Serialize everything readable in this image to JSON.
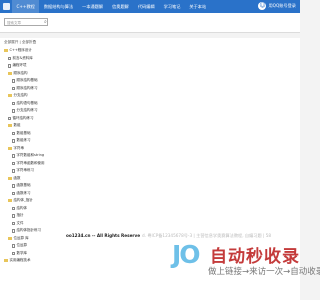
{
  "header": {
    "nav": [
      "C++教程",
      "数据结构与算法",
      "一本通题解",
      "信奥题解",
      "代码编辑",
      "学习笔记",
      "关于本站"
    ],
    "login_label": "用QQ账号登录"
  },
  "search": {
    "placeholder": "搜索文章",
    "button_icon": "search-icon"
  },
  "sidebar": {
    "breadcrumb": "全部展开 | 全部折叠",
    "tree": [
      {
        "label": "C++程序设计",
        "type": "folder",
        "level": 0
      },
      {
        "label": "前言&资料库",
        "type": "file",
        "level": 1
      },
      {
        "label": "编程环境",
        "type": "file",
        "level": 1
      },
      {
        "label": "顺序结构",
        "type": "folder",
        "level": 1
      },
      {
        "label": "顺序结构基础",
        "type": "file",
        "level": 2
      },
      {
        "label": "顺序结构练习",
        "type": "file",
        "level": 2
      },
      {
        "label": "分支结构",
        "type": "folder",
        "level": 1
      },
      {
        "label": "结构语句基础",
        "type": "file",
        "level": 2
      },
      {
        "label": "分支结构练习",
        "type": "file",
        "level": 2
      },
      {
        "label": "循环结构练习",
        "type": "file",
        "level": 1
      },
      {
        "label": "数组",
        "type": "folder",
        "level": 1
      },
      {
        "label": "数组基础",
        "type": "file",
        "level": 2
      },
      {
        "label": "数组练习",
        "type": "file",
        "level": 2
      },
      {
        "label": "字符串",
        "type": "folder",
        "level": 1
      },
      {
        "label": "字符数组和string",
        "type": "file",
        "level": 2
      },
      {
        "label": "字符串函数和使用",
        "type": "file",
        "level": 2
      },
      {
        "label": "字符串练习",
        "type": "file",
        "level": 2
      },
      {
        "label": "函数",
        "type": "folder",
        "level": 1
      },
      {
        "label": "函数基础",
        "type": "file",
        "level": 2
      },
      {
        "label": "函数练习",
        "type": "file",
        "level": 2
      },
      {
        "label": "结构体_指针",
        "type": "folder",
        "level": 1
      },
      {
        "label": "结构体",
        "type": "file",
        "level": 2
      },
      {
        "label": "指针",
        "type": "file",
        "level": 2
      },
      {
        "label": "文件",
        "type": "file",
        "level": 2
      },
      {
        "label": "结构体指针练习",
        "type": "file",
        "level": 2
      },
      {
        "label": "位运算 库",
        "type": "folder",
        "level": 1
      },
      {
        "label": "位运算",
        "type": "file",
        "level": 2
      },
      {
        "label": "数学库",
        "type": "file",
        "level": 2
      },
      {
        "label": "实用编程技术",
        "type": "folder",
        "level": 0
      }
    ]
  },
  "footer": {
    "copyright": "oo1234.cn -- All Rights Reserve",
    "extra": "d. 粤ICP备12345678号-3 | 主营信息学奥赛算法教程, 自编习题 | 58"
  },
  "watermark": {
    "mark": "JO",
    "title": "自动秒收录",
    "subtitle": "做上链接→来访一次→自动收录"
  },
  "colors": {
    "topbar": "#2a72c9",
    "folder": "#e8c55a",
    "watermark_title": "#c43b3b",
    "watermark_mark": "#6ec0e8"
  }
}
